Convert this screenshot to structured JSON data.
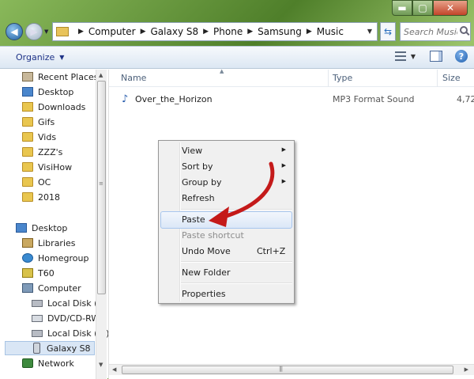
{
  "window": {
    "controls": {
      "minimize": "▬",
      "maximize": "▢",
      "close": "✕"
    }
  },
  "address": {
    "crumbs": [
      "Computer",
      "Galaxy S8",
      "Phone",
      "Samsung",
      "Music"
    ],
    "search_placeholder": "Search Music"
  },
  "toolbar": {
    "organize_label": "Organize"
  },
  "navpane": {
    "items": [
      {
        "label": "Recent Places",
        "icon": "recent-places-icon"
      },
      {
        "label": "Desktop",
        "icon": "desktop-icon"
      },
      {
        "label": "Downloads",
        "icon": "downloads-icon"
      },
      {
        "label": "Gifs",
        "icon": "folder-icon"
      },
      {
        "label": "Vids",
        "icon": "folder-icon"
      },
      {
        "label": "ZZZ's",
        "icon": "folder-icon"
      },
      {
        "label": "VisiHow",
        "icon": "folder-icon"
      },
      {
        "label": "OC",
        "icon": "folder-icon"
      },
      {
        "label": "2018",
        "icon": "folder-icon"
      },
      {
        "label": "Desktop",
        "icon": "desktop-icon"
      },
      {
        "label": "Libraries",
        "icon": "libraries-icon"
      },
      {
        "label": "Homegroup",
        "icon": "homegroup-icon"
      },
      {
        "label": "T60",
        "icon": "user-icon"
      },
      {
        "label": "Computer",
        "icon": "computer-icon"
      },
      {
        "label": "Local Disk (C:",
        "icon": "local-disk-icon"
      },
      {
        "label": "DVD/CD-RW",
        "icon": "dvd-drive-icon"
      },
      {
        "label": "Local Disk (E:)",
        "icon": "local-disk-icon"
      },
      {
        "label": "Galaxy S8",
        "icon": "phone-icon",
        "selected": true
      },
      {
        "label": "Network",
        "icon": "network-icon"
      }
    ]
  },
  "content": {
    "columns": {
      "name": "Name",
      "type": "Type",
      "size": "Size"
    },
    "files": [
      {
        "name": "Over_the_Horizon",
        "type": "MP3 Format Sound",
        "size": "4,72"
      }
    ]
  },
  "context_menu": {
    "view": "View",
    "sort_by": "Sort by",
    "group_by": "Group by",
    "refresh": "Refresh",
    "paste": "Paste",
    "paste_shortcut": "Paste shortcut",
    "undo_move": "Undo Move",
    "undo_shortcut": "Ctrl+Z",
    "new_folder": "New Folder",
    "properties": "Properties"
  },
  "colors": {
    "annotation_arrow": "#c41a1a",
    "menu_hover": "#dbe7f7"
  }
}
